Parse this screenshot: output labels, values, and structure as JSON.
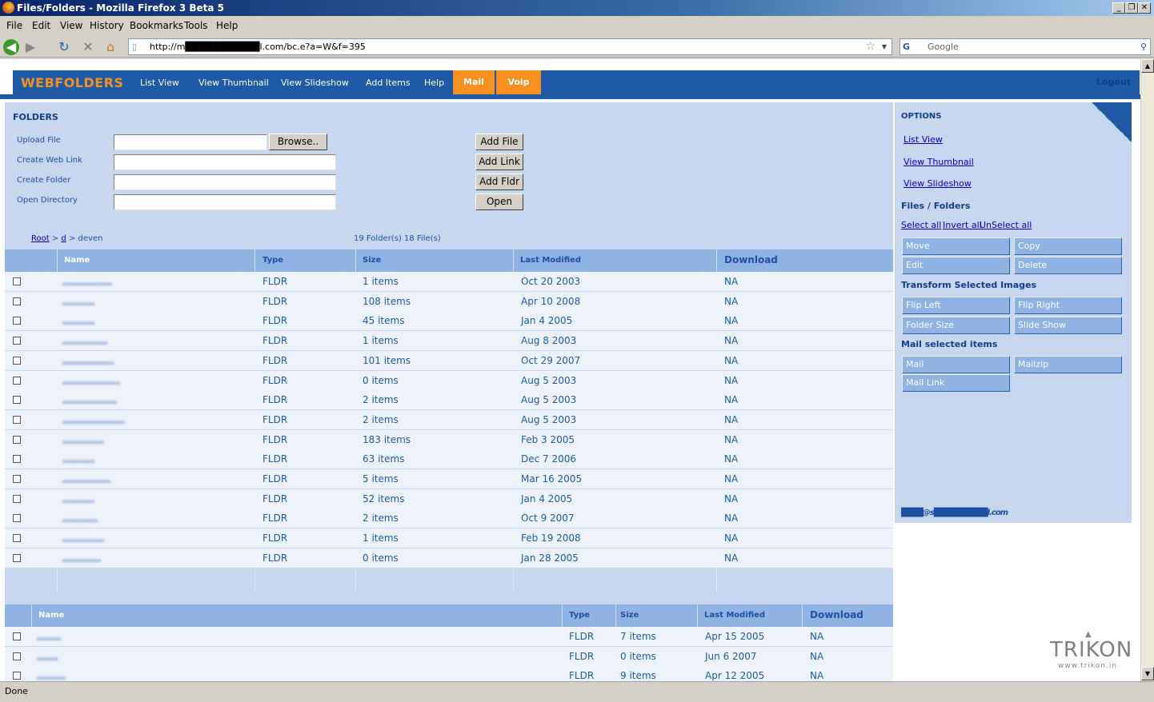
{
  "window": {
    "title": "Files/Folders - Mozilla Firefox 3 Beta 5"
  },
  "menubar": [
    "File",
    "Edit",
    "View",
    "History",
    "Bookmarks",
    "Tools",
    "Help"
  ],
  "browser": {
    "url": "http://m███████████l.com/bc.e?a=W&f=395",
    "search_placeholder": "Google"
  },
  "app": {
    "logo": "WEBFOLDERS",
    "nav": [
      "List View",
      "View Thumbnail",
      "View Slideshow",
      "Add Items",
      "Help"
    ],
    "nav_highlight": [
      "Mail",
      "Voip"
    ],
    "logout": "Logout",
    "brand_color": "#1f5aa6",
    "accent_color": "#f7901e"
  },
  "folders": {
    "heading": "FOLDERS",
    "form": [
      {
        "label": "Upload File",
        "button": "Add File",
        "browse": "Browse.."
      },
      {
        "label": "Create Web Link",
        "button": "Add Link"
      },
      {
        "label": "Create Folder",
        "button": "Add Fldr"
      },
      {
        "label": "Open Directory",
        "button": "Open"
      }
    ],
    "breadcrumb": {
      "root": "Root",
      "sep": ">",
      "d": "d",
      "current": "deven"
    },
    "summary": "19 Folder(s) 18 File(s)"
  },
  "table1": {
    "headers": [
      "Name",
      "Type",
      "Size",
      "Last Modified",
      "Download"
    ],
    "rows": [
      {
        "type": "FLDR",
        "size": "1 items",
        "modified": "Oct 20 2003",
        "download": "NA"
      },
      {
        "type": "FLDR",
        "size": "108 items",
        "modified": "Apr 10 2008",
        "download": "NA"
      },
      {
        "type": "FLDR",
        "size": "45 items",
        "modified": "Jan 4 2005",
        "download": "NA"
      },
      {
        "type": "FLDR",
        "size": "1 items",
        "modified": "Aug 8 2003",
        "download": "NA"
      },
      {
        "type": "FLDR",
        "size": "101 items",
        "modified": "Oct 29 2007",
        "download": "NA"
      },
      {
        "type": "FLDR",
        "size": "0 items",
        "modified": "Aug 5 2003",
        "download": "NA"
      },
      {
        "type": "FLDR",
        "size": "2 items",
        "modified": "Aug 5 2003",
        "download": "NA"
      },
      {
        "type": "FLDR",
        "size": "2 items",
        "modified": "Aug 5 2003",
        "download": "NA"
      },
      {
        "type": "FLDR",
        "size": "183 items",
        "modified": "Feb 3 2005",
        "download": "NA"
      },
      {
        "type": "FLDR",
        "size": "63 items",
        "modified": "Dec 7 2006",
        "download": "NA"
      },
      {
        "type": "FLDR",
        "size": "5 items",
        "modified": "Mar 16 2005",
        "download": "NA"
      },
      {
        "type": "FLDR",
        "size": "52 items",
        "modified": "Jan 4 2005",
        "download": "NA"
      },
      {
        "type": "FLDR",
        "size": "2 items",
        "modified": "Oct 9 2007",
        "download": "NA"
      },
      {
        "type": "FLDR",
        "size": "1 items",
        "modified": "Feb 19 2008",
        "download": "NA"
      },
      {
        "type": "FLDR",
        "size": "0 items",
        "modified": "Jan 28 2005",
        "download": "NA"
      }
    ]
  },
  "table2": {
    "headers": [
      "Name",
      "Type",
      "Size",
      "Last Modified",
      "Download"
    ],
    "rows": [
      {
        "type": "FLDR",
        "size": "7 items",
        "modified": "Apr 15 2005",
        "download": "NA"
      },
      {
        "type": "FLDR",
        "size": "0 items",
        "modified": "Jun 6 2007",
        "download": "NA"
      },
      {
        "type": "FLDR",
        "size": "9 items",
        "modified": "Apr 12 2005",
        "download": "NA"
      }
    ]
  },
  "options": {
    "heading": "OPTIONS",
    "views": [
      "List View",
      "View Thumbnail",
      "View Slideshow"
    ],
    "files_heading": "Files / Folders",
    "select": [
      "Select all",
      "Invert all",
      "UnSelect all"
    ],
    "file_actions": [
      "Move",
      "Copy",
      "Edit",
      "Delete"
    ],
    "transform_heading": "Transform Selected Images",
    "transform_actions": [
      "Flip Left",
      "Flip Right",
      "Folder Size",
      "Slide Show"
    ],
    "mail_heading": "Mail selected items",
    "mail_actions": [
      "Mail",
      "Mailzip",
      "Mail Link"
    ],
    "email": "████@s██████████l.com"
  },
  "footer_logo": {
    "name": "TRIKON",
    "url": "www.trikon.in"
  },
  "status": "Done"
}
